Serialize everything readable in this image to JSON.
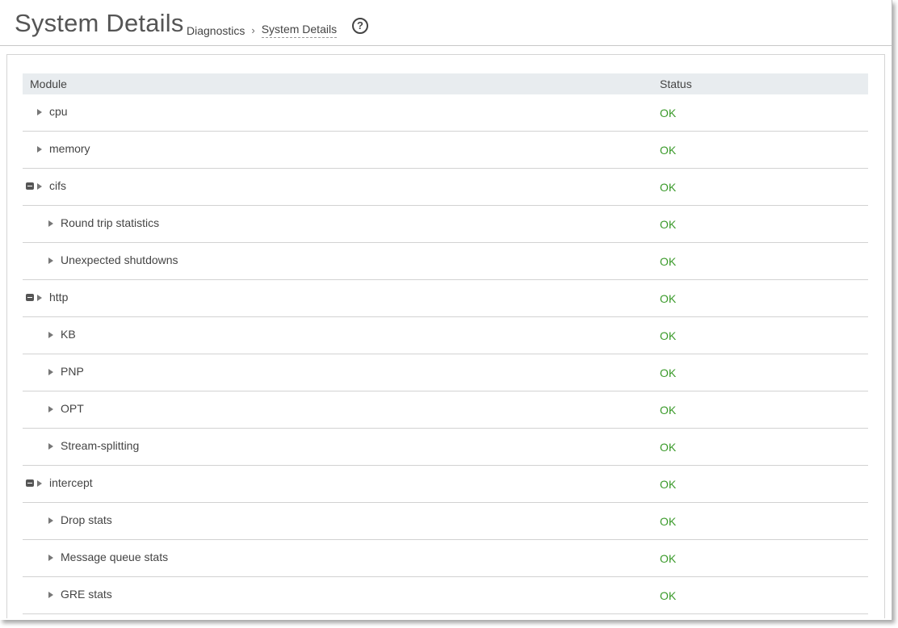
{
  "page": {
    "title": "System Details",
    "breadcrumb": {
      "parent": "Diagnostics",
      "separator": "›",
      "current": "System Details"
    },
    "help_icon": "help-circle-icon",
    "help_glyph": "?"
  },
  "table": {
    "headers": {
      "module": "Module",
      "status": "Status"
    },
    "rows": [
      {
        "label": "cpu",
        "status": "OK",
        "level": 0,
        "expanded": false
      },
      {
        "label": "memory",
        "status": "OK",
        "level": 0,
        "expanded": false
      },
      {
        "label": "cifs",
        "status": "OK",
        "level": 0,
        "expanded": true
      },
      {
        "label": "Round trip statistics",
        "status": "OK",
        "level": 1,
        "expanded": false
      },
      {
        "label": "Unexpected shutdowns",
        "status": "OK",
        "level": 1,
        "expanded": false
      },
      {
        "label": "http",
        "status": "OK",
        "level": 0,
        "expanded": true
      },
      {
        "label": "KB",
        "status": "OK",
        "level": 1,
        "expanded": false
      },
      {
        "label": "PNP",
        "status": "OK",
        "level": 1,
        "expanded": false
      },
      {
        "label": "OPT",
        "status": "OK",
        "level": 1,
        "expanded": false
      },
      {
        "label": "Stream-splitting",
        "status": "OK",
        "level": 1,
        "expanded": false
      },
      {
        "label": "intercept",
        "status": "OK",
        "level": 0,
        "expanded": true
      },
      {
        "label": "Drop stats",
        "status": "OK",
        "level": 1,
        "expanded": false
      },
      {
        "label": "Message queue stats",
        "status": "OK",
        "level": 1,
        "expanded": false
      },
      {
        "label": "GRE stats",
        "status": "OK",
        "level": 1,
        "expanded": false
      }
    ]
  },
  "colors": {
    "status_ok": "#3a9a2a",
    "header_bg": "#e8ecef"
  }
}
